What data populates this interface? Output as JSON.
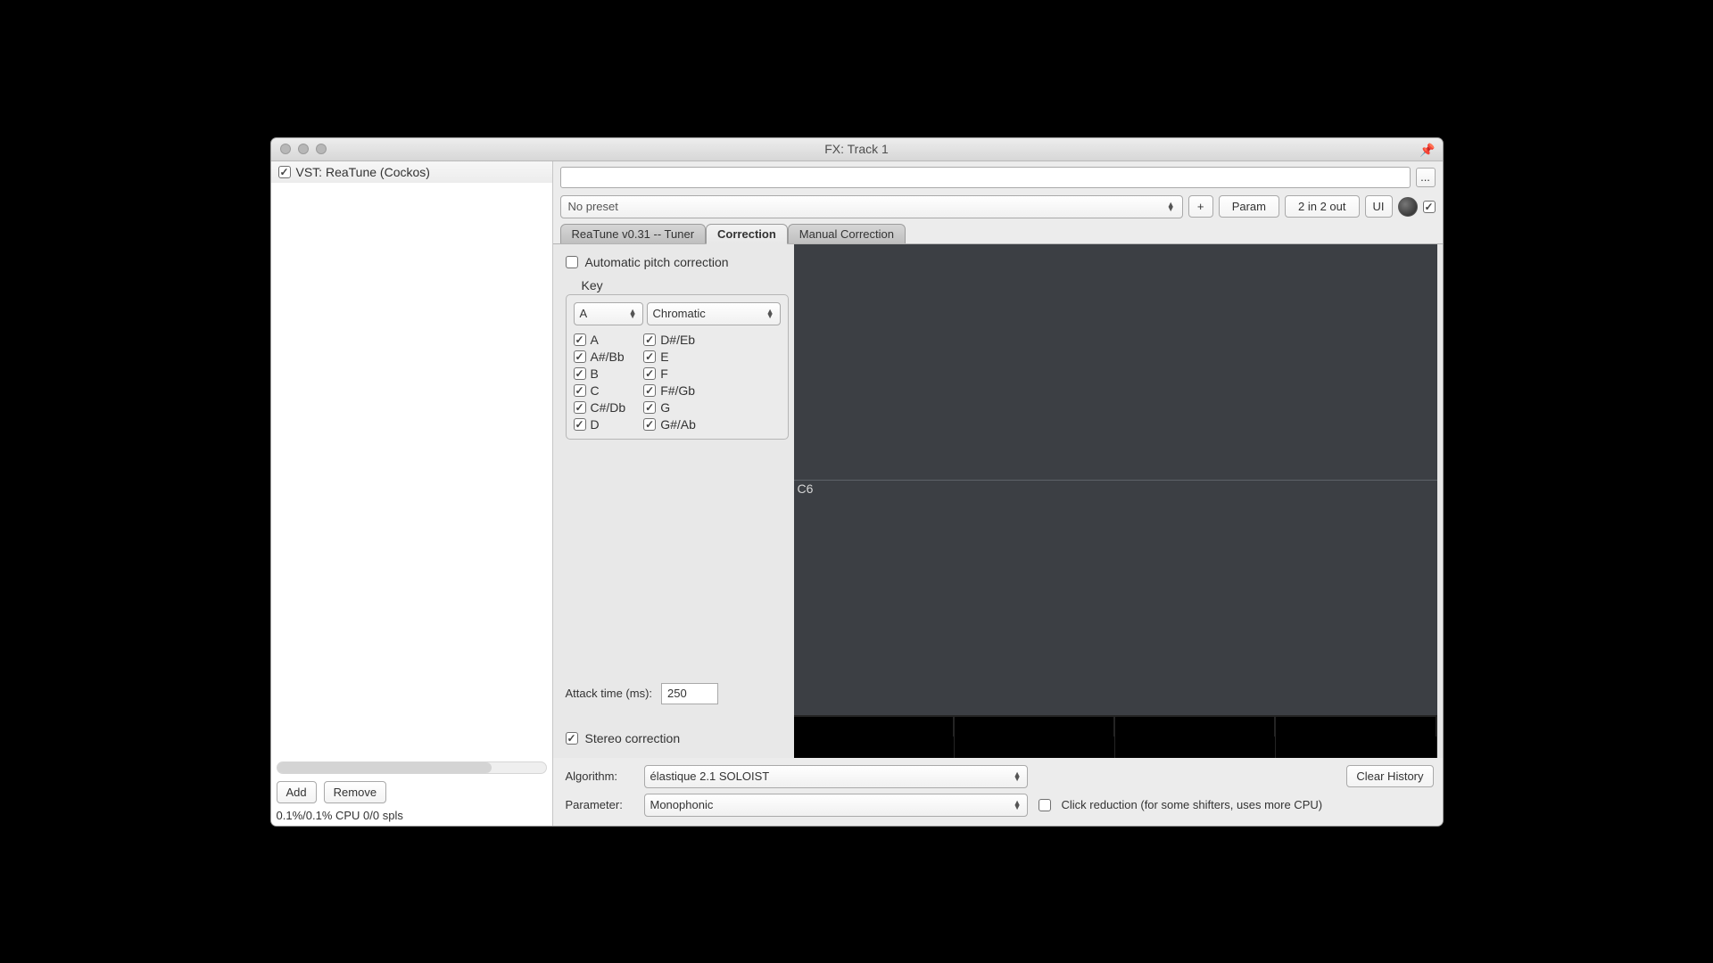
{
  "window": {
    "title": "FX: Track 1"
  },
  "sidebar": {
    "items": [
      {
        "checked": true,
        "label": "VST: ReaTune (Cockos)"
      }
    ],
    "add_label": "Add",
    "remove_label": "Remove",
    "status": "0.1%/0.1% CPU 0/0 spls"
  },
  "toolbar": {
    "preset_label": "No preset",
    "plus_label": "+",
    "param_label": "Param",
    "io_label": "2 in 2 out",
    "ui_label": "UI",
    "menu_label": "..."
  },
  "tabs": [
    {
      "label": "ReaTune v0.31 -- Tuner",
      "active": false
    },
    {
      "label": "Correction",
      "active": true
    },
    {
      "label": "Manual Correction",
      "active": false
    }
  ],
  "correction": {
    "auto_label": "Automatic pitch correction",
    "key_label": "Key",
    "key_root": "A",
    "key_scale": "Chromatic",
    "notes_col1": [
      "A",
      "A#/Bb",
      "B",
      "C",
      "C#/Db",
      "D"
    ],
    "notes_col2": [
      "D#/Eb",
      "E",
      "F",
      "F#/Gb",
      "G",
      "G#/Ab"
    ],
    "attack_label": "Attack time (ms):",
    "attack_value": "250",
    "stereo_label": "Stereo correction",
    "vis_note": "C6"
  },
  "bottom": {
    "algo_label": "Algorithm:",
    "algo_value": "élastique 2.1 SOLOIST",
    "param_label": "Parameter:",
    "param_value": "Monophonic",
    "clear_label": "Clear History",
    "click_label": "Click reduction (for some shifters, uses more CPU)"
  }
}
